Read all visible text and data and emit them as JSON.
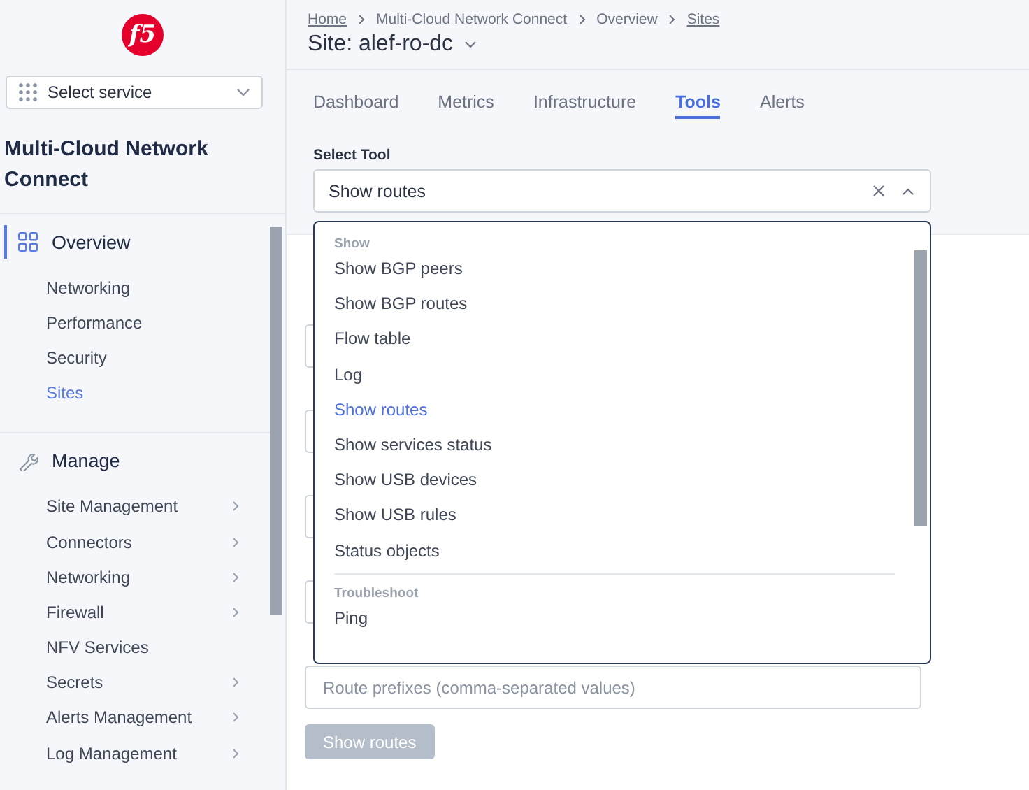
{
  "logo": {
    "text": "f5"
  },
  "sidebar": {
    "service_select": {
      "placeholder": "Select service"
    },
    "title": "Multi-Cloud Network Connect",
    "sections": [
      {
        "label": "Overview",
        "selected": true,
        "items": [
          {
            "label": "Networking",
            "selected": false,
            "submenu": false
          },
          {
            "label": "Performance",
            "selected": false,
            "submenu": false
          },
          {
            "label": "Security",
            "selected": false,
            "submenu": false
          },
          {
            "label": "Sites",
            "selected": true,
            "submenu": false
          }
        ]
      },
      {
        "label": "Manage",
        "selected": false,
        "items": [
          {
            "label": "Site Management",
            "selected": false,
            "submenu": true
          },
          {
            "label": "Connectors",
            "selected": false,
            "submenu": true
          },
          {
            "label": "Networking",
            "selected": false,
            "submenu": true
          },
          {
            "label": "Firewall",
            "selected": false,
            "submenu": true
          },
          {
            "label": "NFV Services",
            "selected": false,
            "submenu": false
          },
          {
            "label": "Secrets",
            "selected": false,
            "submenu": true
          },
          {
            "label": "Alerts Management",
            "selected": false,
            "submenu": true
          },
          {
            "label": "Log Management",
            "selected": false,
            "submenu": true
          }
        ]
      }
    ]
  },
  "breadcrumb": [
    {
      "label": "Home",
      "link": true
    },
    {
      "label": "Multi-Cloud Network Connect",
      "link": false
    },
    {
      "label": "Overview",
      "link": false
    },
    {
      "label": "Sites",
      "link": true
    }
  ],
  "page_title": "Site: alef-ro-dc",
  "tabs": [
    {
      "label": "Dashboard",
      "selected": false
    },
    {
      "label": "Metrics",
      "selected": false
    },
    {
      "label": "Infrastructure",
      "selected": false
    },
    {
      "label": "Tools",
      "selected": true
    },
    {
      "label": "Alerts",
      "selected": false
    }
  ],
  "tool_select": {
    "label": "Select Tool",
    "value": "Show routes",
    "expanded": true
  },
  "dropdown": [
    {
      "group": "Show",
      "options": [
        {
          "label": "Show BGP peers",
          "selected": false
        },
        {
          "label": "Show BGP routes",
          "selected": false
        },
        {
          "label": "Flow table",
          "selected": false
        },
        {
          "label": "Log",
          "selected": false
        },
        {
          "label": "Show routes",
          "selected": true
        },
        {
          "label": "Show services status",
          "selected": false
        },
        {
          "label": "Show USB devices",
          "selected": false
        },
        {
          "label": "Show USB rules",
          "selected": false
        },
        {
          "label": "Status objects",
          "selected": false
        }
      ]
    },
    {
      "group": "Troubleshoot",
      "options": [
        {
          "label": "Ping",
          "selected": false
        }
      ]
    }
  ],
  "route_field": {
    "placeholder": "Route prefixes (comma-separated values)"
  },
  "submit_button": {
    "label": "Show routes",
    "disabled": true
  }
}
